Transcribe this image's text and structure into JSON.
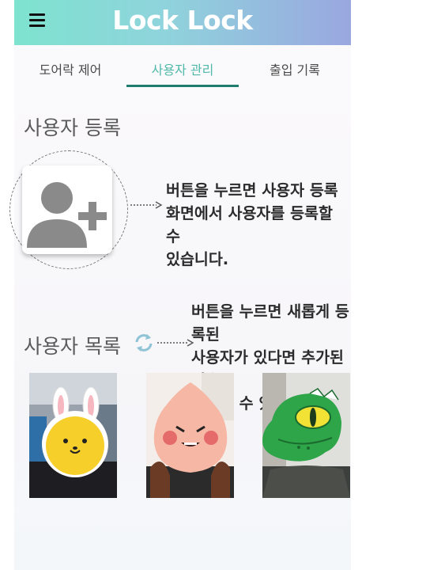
{
  "header": {
    "title": "Lock Lock",
    "menu_icon": "hamburger-menu-icon",
    "gradient_start": "#7ee3cf",
    "gradient_end": "#9aa7e0"
  },
  "tabs": [
    {
      "label": "도어락 제어",
      "active": false
    },
    {
      "label": "사용자 관리",
      "active": true
    },
    {
      "label": "출입 기록",
      "active": false
    }
  ],
  "accent_color": "#4fb9a9",
  "register": {
    "title": "사용자 등록",
    "button_icon": "add-user-icon",
    "annotation_lines": [
      "버튼을 누르면 사용자 등록",
      "화면에서 사용자를 등록할 수",
      "있습니다."
    ]
  },
  "user_list": {
    "title": "사용자 목록",
    "refresh_icon": "refresh-icon",
    "annotation_lines": [
      "버튼을 누르면 새롭게 등록된",
      "사용자가 있다면 추가된 것을",
      "확인할 수 있습니다."
    ],
    "photos": [
      {
        "icon": "yellow-bunny-character-face-icon"
      },
      {
        "icon": "peach-character-face-icon"
      },
      {
        "icon": "green-crocodile-character-face-icon"
      }
    ]
  }
}
